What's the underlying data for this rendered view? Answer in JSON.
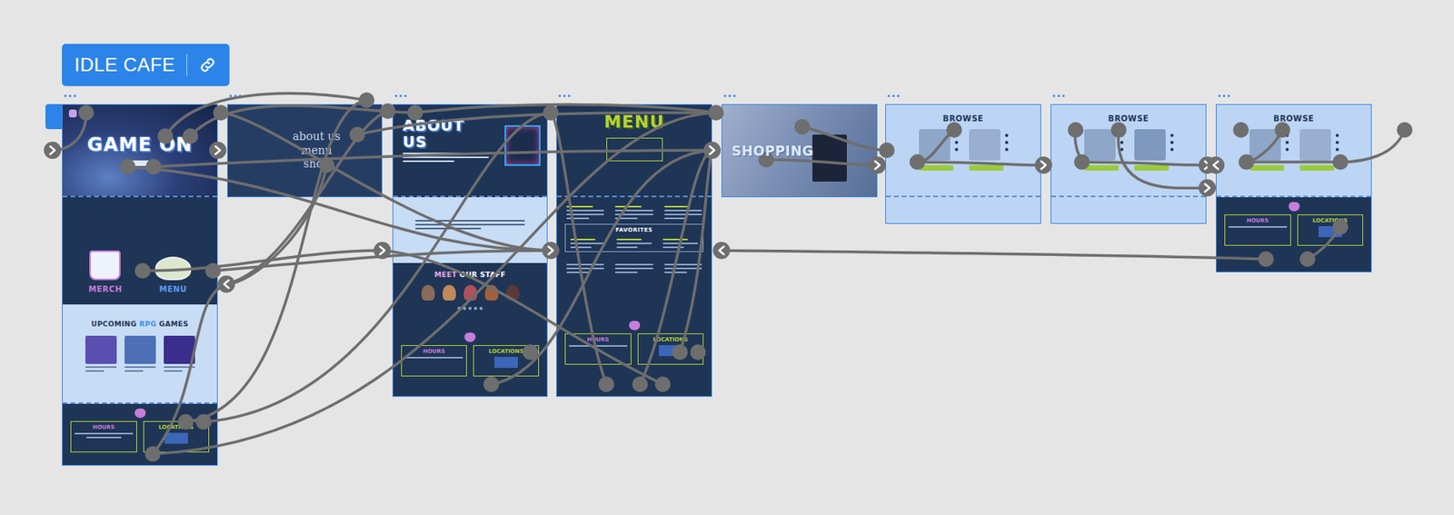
{
  "flow": {
    "name": "IDLE CAFE",
    "selected": true
  },
  "home": {
    "hero": "GAME ON",
    "tiles": [
      {
        "label": "MERCH",
        "color": "#c77ddb"
      },
      {
        "label": "MENU",
        "color": "#5b9cf0"
      }
    ],
    "upcoming": [
      {
        "text": "UPCOMING ",
        "accent": false
      },
      {
        "text": "RPG",
        "accent": true
      },
      {
        "text": " GAMES",
        "accent": false
      }
    ],
    "games": [
      {
        "color": "#5a4fb0"
      },
      {
        "color": "#4d6fb5"
      },
      {
        "color": "#3a2d8c"
      }
    ]
  },
  "nav_frame": {
    "links": [
      "about us",
      "menu",
      "shop"
    ]
  },
  "about": {
    "title": "ABOUT US",
    "staff_title": [
      {
        "text": "MEET",
        "accent": true
      },
      {
        "text": " OUR STAFF",
        "accent": false
      }
    ],
    "staff": [
      {
        "color": "#8a6a5a"
      },
      {
        "color": "#c08a5a"
      },
      {
        "color": "#b0505a"
      },
      {
        "color": "#a0603a"
      },
      {
        "color": "#5a3a3a"
      }
    ]
  },
  "menu_page": {
    "title": "MENU",
    "favorites": "FAVORITES"
  },
  "shop": {
    "title": "SHOPPING"
  },
  "browse": [
    {
      "title": "BROWSE",
      "footer": false,
      "products": [
        {
          "color": "#8ea6c8"
        },
        {
          "color": "#9aaed0"
        }
      ]
    },
    {
      "title": "BROWSE",
      "footer": false,
      "products": [
        {
          "color": "#8ea6c8"
        },
        {
          "color": "#7f98be"
        }
      ]
    },
    {
      "title": "BROWSE",
      "footer": true,
      "products": [
        {
          "color": "#8ea6c8"
        },
        {
          "color": "#9aaed0"
        }
      ]
    }
  ],
  "footer": {
    "hours": "HOURS",
    "locations": "LOCATIONS"
  }
}
